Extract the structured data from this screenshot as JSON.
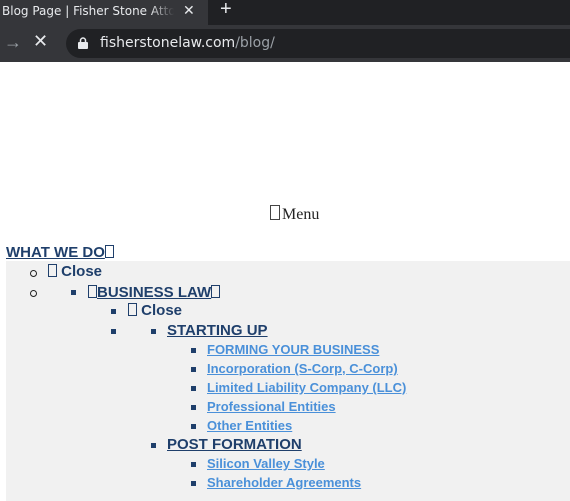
{
  "browser": {
    "tab_title": "Blog Page | Fisher Stone Attorneys",
    "tab_close": "✕",
    "new_tab": "+",
    "forward": "→",
    "stop": "✕",
    "url_host": "fisherstonelaw.com",
    "url_path": "/blog/"
  },
  "header": {
    "menu_label": "Menu",
    "menu_icon": "menu-icon"
  },
  "nav": {
    "what_we_do": "WHAT WE DO",
    "close_1": "Close",
    "business_law": "BUSINESS LAW",
    "close_2": "Close",
    "starting_up": {
      "label": "STARTING UP",
      "items": [
        "FORMING YOUR BUSINESS",
        "Incorporation (S-Corp, C-Corp)",
        "Limited Liability Company (LLC)",
        "Professional Entities",
        "Other Entities"
      ]
    },
    "post_formation": {
      "label": "POST FORMATION",
      "items": [
        "Silicon Valley Style",
        "Shareholder Agreements"
      ]
    }
  },
  "colors": {
    "dark_link": "#1f3f6b",
    "light_link": "#4a90d9",
    "menu_bg": "#f1f1f1"
  }
}
